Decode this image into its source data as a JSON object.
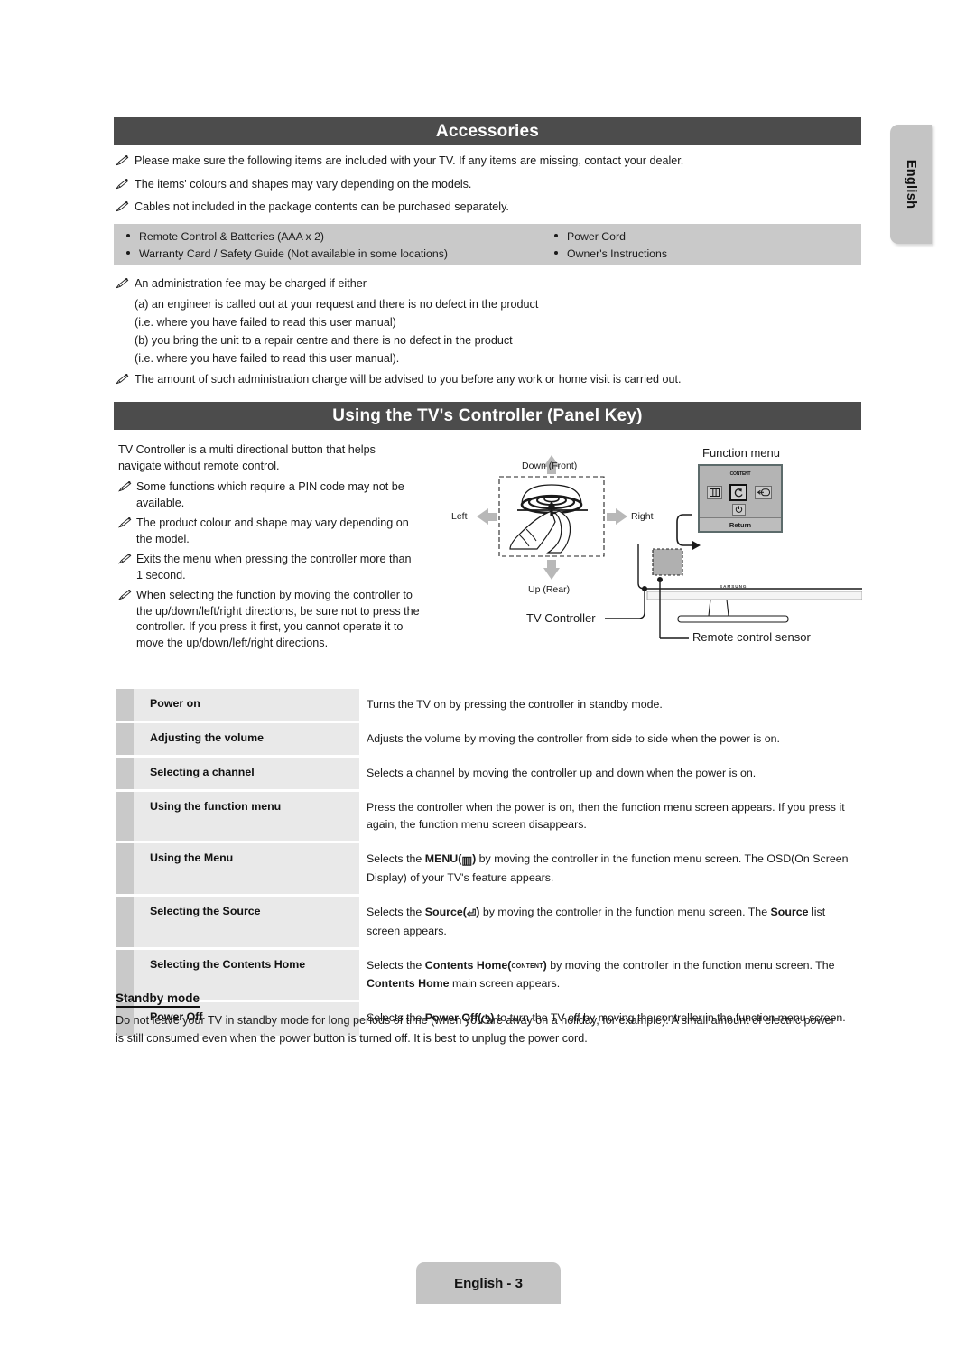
{
  "language_tab": {
    "label": "English"
  },
  "sections": {
    "accessories": {
      "title": "Accessories",
      "notes": [
        "Please make sure the following items are included with your TV. If any items are missing, contact your dealer.",
        "The items' colours and shapes may vary depending on the models.",
        "Cables not included in the package contents can be purchased separately."
      ],
      "items_left": [
        "Remote Control & Batteries (AAA x 2)",
        "Warranty Card / Safety Guide (Not available in some locations)"
      ],
      "items_right": [
        "Power Cord",
        "Owner's Instructions"
      ],
      "fee_note": "An administration fee may be charged if either",
      "fee_lines": [
        "(a) an engineer is called out at your request and there is no defect in the product",
        "(i.e. where you have failed to read this user manual)",
        "(b) you bring the unit to a repair centre and there is no defect in the product",
        "(i.e. where you have failed to read this user manual)."
      ],
      "charge_note": "The amount of such administration charge will be advised to you before any work or home visit is carried out."
    },
    "controller": {
      "title": "Using the TV's Controller (Panel Key)",
      "intro": "TV Controller is a multi directional button that helps navigate without remote control.",
      "notes": [
        "Some functions which require a PIN code may not be available.",
        "The product colour and shape may vary depending on the model.",
        "Exits the menu when pressing the controller more than 1 second.",
        "When selecting the function by moving the controller to the up/down/left/right directions, be sure not to press the controller. If you press it first, you cannot operate it to move the up/down/left/right directions."
      ],
      "diagram": {
        "label_down": "Down (Front)",
        "label_up": "Up (Rear)",
        "label_left": "Left",
        "label_right": "Right",
        "label_controller": "TV Controller",
        "label_sensor": "Remote control sensor",
        "label_function_menu": "Function menu",
        "function_menu": {
          "content_key": "CONTENT",
          "return_key": "Return"
        },
        "brand": "SAMSUNG"
      },
      "table": [
        {
          "label": "Power on",
          "desc_html": "Turns the TV on by pressing the controller in standby mode."
        },
        {
          "label": "Adjusting the volume",
          "desc_html": "Adjusts the volume by moving the controller from side to side when the power is on."
        },
        {
          "label": "Selecting a channel",
          "desc_html": "Selects a channel by moving the controller up and down when the power is on."
        },
        {
          "label": "Using the function menu",
          "desc_html": "Press the controller when the power is on, then the function menu screen appears. If you press it again, the function menu screen disappears."
        },
        {
          "label": "Using the Menu",
          "desc_html": "Selects the <b>MENU(<span class=\"glyph-menu\">▥</span>)</b> by moving the controller in the function menu screen. The OSD(On Screen Display) of your TV's feature appears."
        },
        {
          "label": "Selecting the Source",
          "desc_html": "Selects the <b>Source(<span class=\"glyph-src\">⏎</span>)</b> by moving the controller in the function menu screen. The <b>Source</b> list screen appears."
        },
        {
          "label": "Selecting the Contents Home",
          "desc_html": "Selects the <b>Contents Home(<span class=\"glyph-content\">CONTENT</span>)</b> by moving the controller in the function menu screen. The <b>Contents Home</b> main screen appears."
        },
        {
          "label": "Power Off",
          "desc_html": "Selects the <b>Power Off(<span class=\"glyph-pwr\">⏻</span>)</b> to turn the TV off by moving the controller in the function menu screen."
        }
      ]
    },
    "standby": {
      "title": "Standby mode",
      "body": "Do not leave your TV in standby mode for long periods of time (when you are away on a holiday, for example). A small amount of electric power is still consumed even when the power button is turned off. It is best to unplug the power cord."
    }
  },
  "footer": {
    "page_label": "English - 3"
  },
  "colors": {
    "header_bar": "#4c4c4c",
    "panel_grey": "#c9c9c9",
    "row_light": "#e9e9e9",
    "row_dark": "#c9c9c9",
    "tab_grey": "#c4c4c4"
  }
}
